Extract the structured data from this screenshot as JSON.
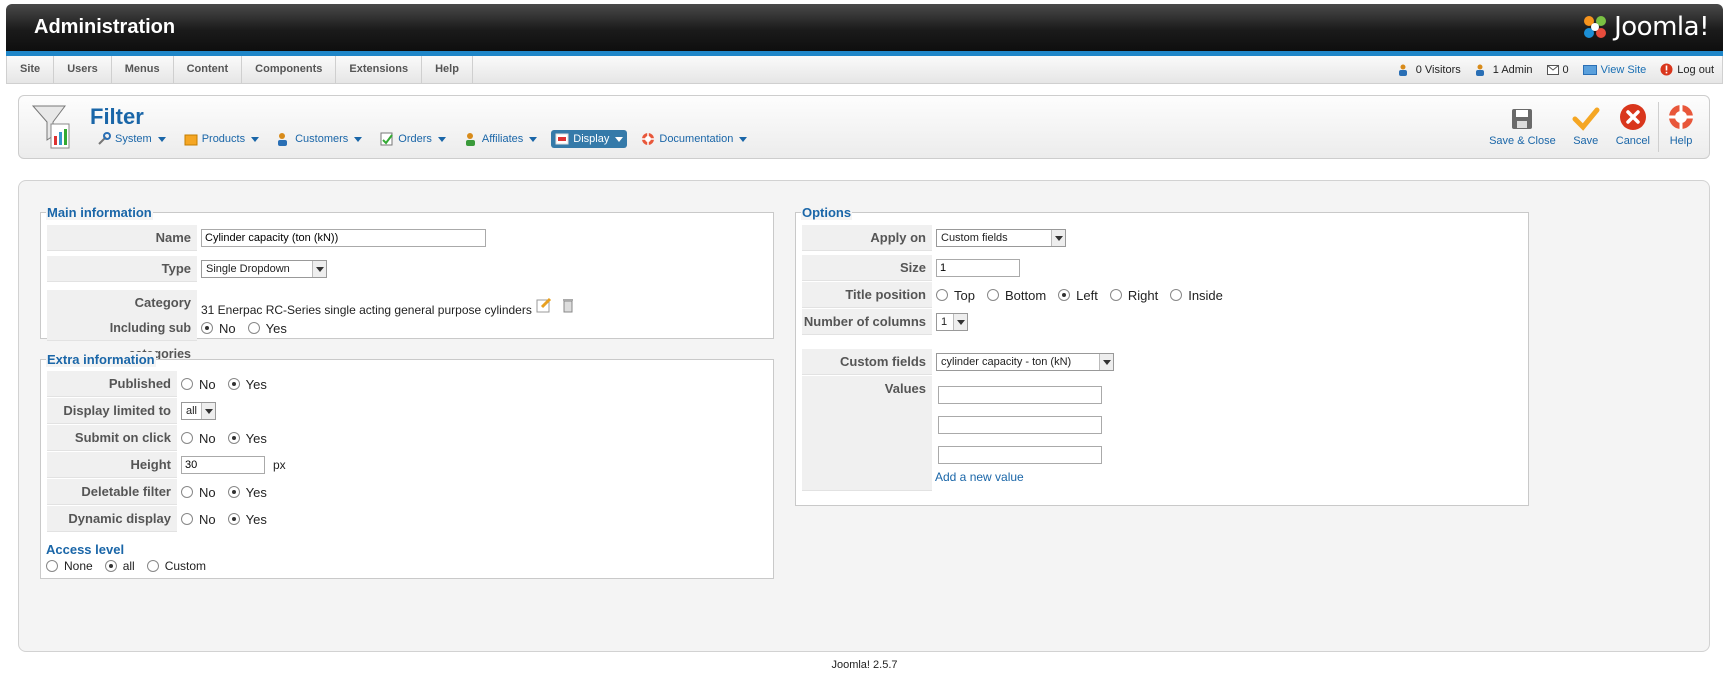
{
  "header": {
    "title": "Administration",
    "logo_text": "Joomla!"
  },
  "menubar": {
    "items": [
      "Site",
      "Users",
      "Menus",
      "Content",
      "Components",
      "Extensions",
      "Help"
    ],
    "status": {
      "visitors": "0 Visitors",
      "admins": "1 Admin",
      "messages": "0",
      "view_site": "View Site",
      "logout": "Log out"
    }
  },
  "toolbar": {
    "title": "Filter",
    "submenu": [
      "System",
      "Products",
      "Customers",
      "Orders",
      "Affiliates",
      "Display",
      "Documentation"
    ],
    "active_submenu": "Display",
    "actions": {
      "save_close": "Save & Close",
      "save": "Save",
      "cancel": "Cancel",
      "help": "Help"
    }
  },
  "main_info": {
    "legend": "Main information",
    "name_label": "Name",
    "name_value": "Cylinder capacity (ton (kN))",
    "type_label": "Type",
    "type_value": "Single Dropdown",
    "category_label": "Category",
    "category_value": "31 Enerpac RC-Series single acting general purpose cylinders",
    "subcat_label": "Including sub categories",
    "no": "No",
    "yes": "Yes"
  },
  "extra_info": {
    "legend": "Extra information",
    "published_label": "Published",
    "display_limited_label": "Display limited to",
    "display_limited_value": "all",
    "submit_label": "Submit on click",
    "height_label": "Height",
    "height_value": "30",
    "height_unit": "px",
    "deletable_label": "Deletable filter",
    "dynamic_label": "Dynamic display",
    "no": "No",
    "yes": "Yes",
    "access_legend": "Access level",
    "access_none": "None",
    "access_all": "all",
    "access_custom": "Custom"
  },
  "options": {
    "legend": "Options",
    "apply_label": "Apply on",
    "apply_value": "Custom fields",
    "size_label": "Size",
    "size_value": "1",
    "title_pos_label": "Title position",
    "title_pos": [
      "Top",
      "Bottom",
      "Left",
      "Right",
      "Inside"
    ],
    "cols_label": "Number of columns",
    "cols_value": "1",
    "custom_fields_label": "Custom fields",
    "custom_fields_value": "cylinder capacity - ton (kN)",
    "values_label": "Values",
    "add_value": "Add a new value"
  },
  "footer": {
    "version": "Joomla! 2.5.7"
  },
  "colors": {
    "accent": "#1a66a8",
    "active_tab": "#357aa9",
    "header_bar": "#1f86c8"
  }
}
